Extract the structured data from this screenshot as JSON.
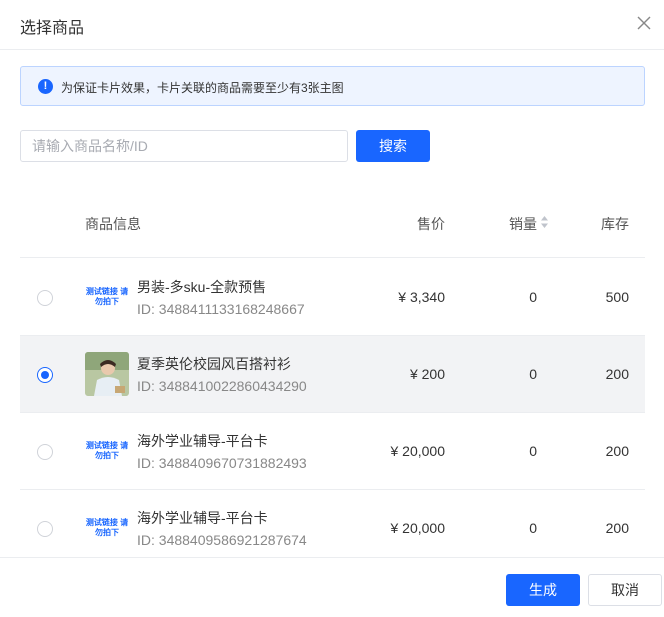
{
  "dialog": {
    "title": "选择商品",
    "close_icon": "close-icon"
  },
  "notice": {
    "icon": "exclamation-circle-icon",
    "text": "为保证卡片效果，卡片关联的商品需要至少有3张主图"
  },
  "search": {
    "placeholder": "请输入商品名称/ID",
    "value": "",
    "button_label": "搜索"
  },
  "table": {
    "columns": {
      "info": "商品信息",
      "price": "售价",
      "sales": "销量",
      "stock": "库存"
    },
    "sort_icon": "sort-caret-icon",
    "rows": [
      {
        "name": "男装-多sku-全款预售",
        "id": "ID: 3488411133168248667",
        "price": "¥ 3,340",
        "sales": "0",
        "stock": "500",
        "selected": false,
        "thumb": "测试链接 请勿拍下"
      },
      {
        "name": "夏季英伦校园风百搭衬衫",
        "id": "ID: 3488410022860434290",
        "price": "¥ 200",
        "sales": "0",
        "stock": "200",
        "selected": true,
        "thumb": ""
      },
      {
        "name": "海外学业辅导-平台卡",
        "id": "ID: 3488409670731882493",
        "price": "¥ 20,000",
        "sales": "0",
        "stock": "200",
        "selected": false,
        "thumb": "测试链接 请勿拍下"
      },
      {
        "name": "海外学业辅导-平台卡",
        "id": "ID: 3488409586921287674",
        "price": "¥ 20,000",
        "sales": "0",
        "stock": "200",
        "selected": false,
        "thumb": "测试链接 请勿拍下"
      }
    ]
  },
  "footer": {
    "generate_label": "生成",
    "cancel_label": "取消"
  },
  "colors": {
    "primary": "#1966ff",
    "notice_bg": "#eef4ff",
    "selected_row_bg": "#f2f3f5"
  }
}
